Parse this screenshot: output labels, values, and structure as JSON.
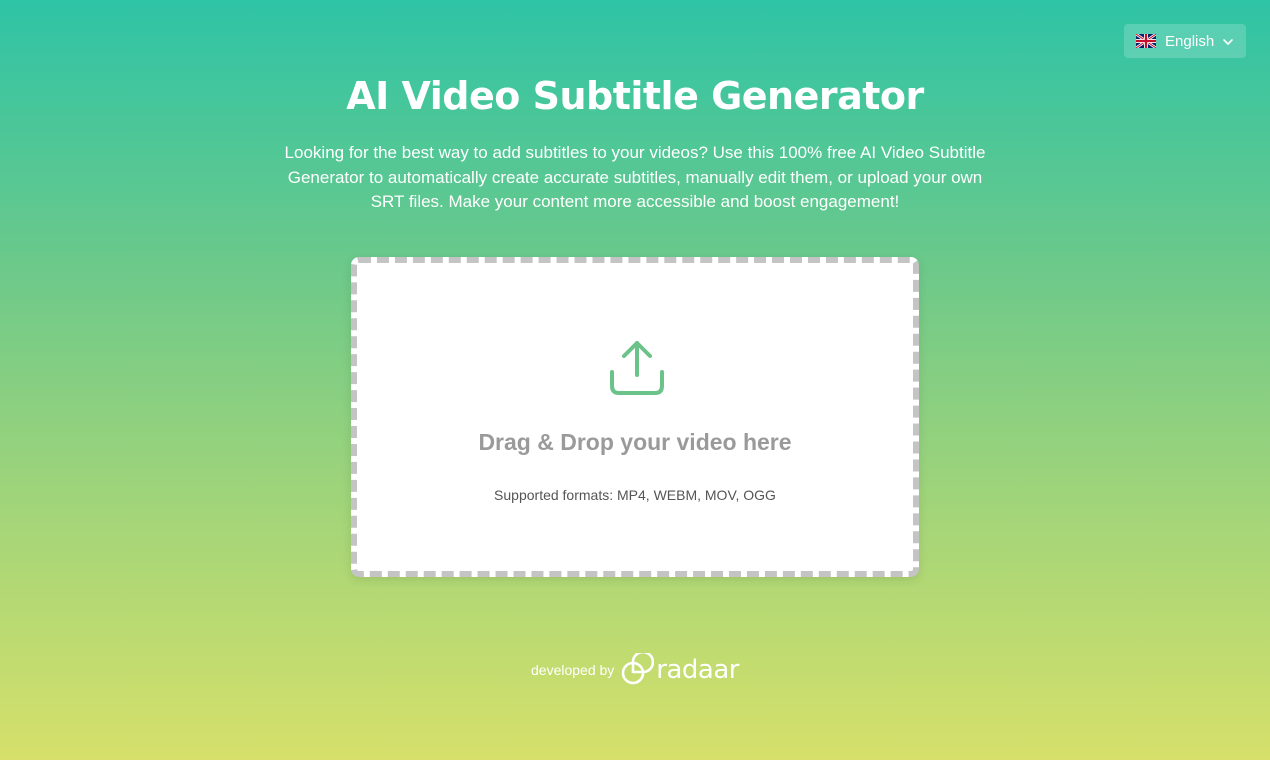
{
  "language_selector": {
    "label": "English",
    "flag_icon": "uk-flag-icon",
    "chevron_icon": "chevron-down-icon"
  },
  "hero": {
    "title": "AI Video Subtitle Generator",
    "description": "Looking for the best way to add subtitles to your videos? Use this 100% free AI Video Subtitle Generator to automatically create accurate subtitles, manually edit them, or upload your own SRT files. Make your content more accessible and boost engagement!"
  },
  "dropzone": {
    "icon": "upload-icon",
    "title": "Drag & Drop your video here",
    "formats": "Supported formats: MP4, WEBM, MOV, OGG"
  },
  "footer": {
    "developed_by": "developed by",
    "brand_name": "radaar"
  },
  "colors": {
    "gradient_top": "#2ec4a6",
    "gradient_bottom": "#d6e06a",
    "icon_green": "#6cc38a",
    "drop_title_gray": "#9a9a9a",
    "dashed_border": "#c4c4c4"
  }
}
